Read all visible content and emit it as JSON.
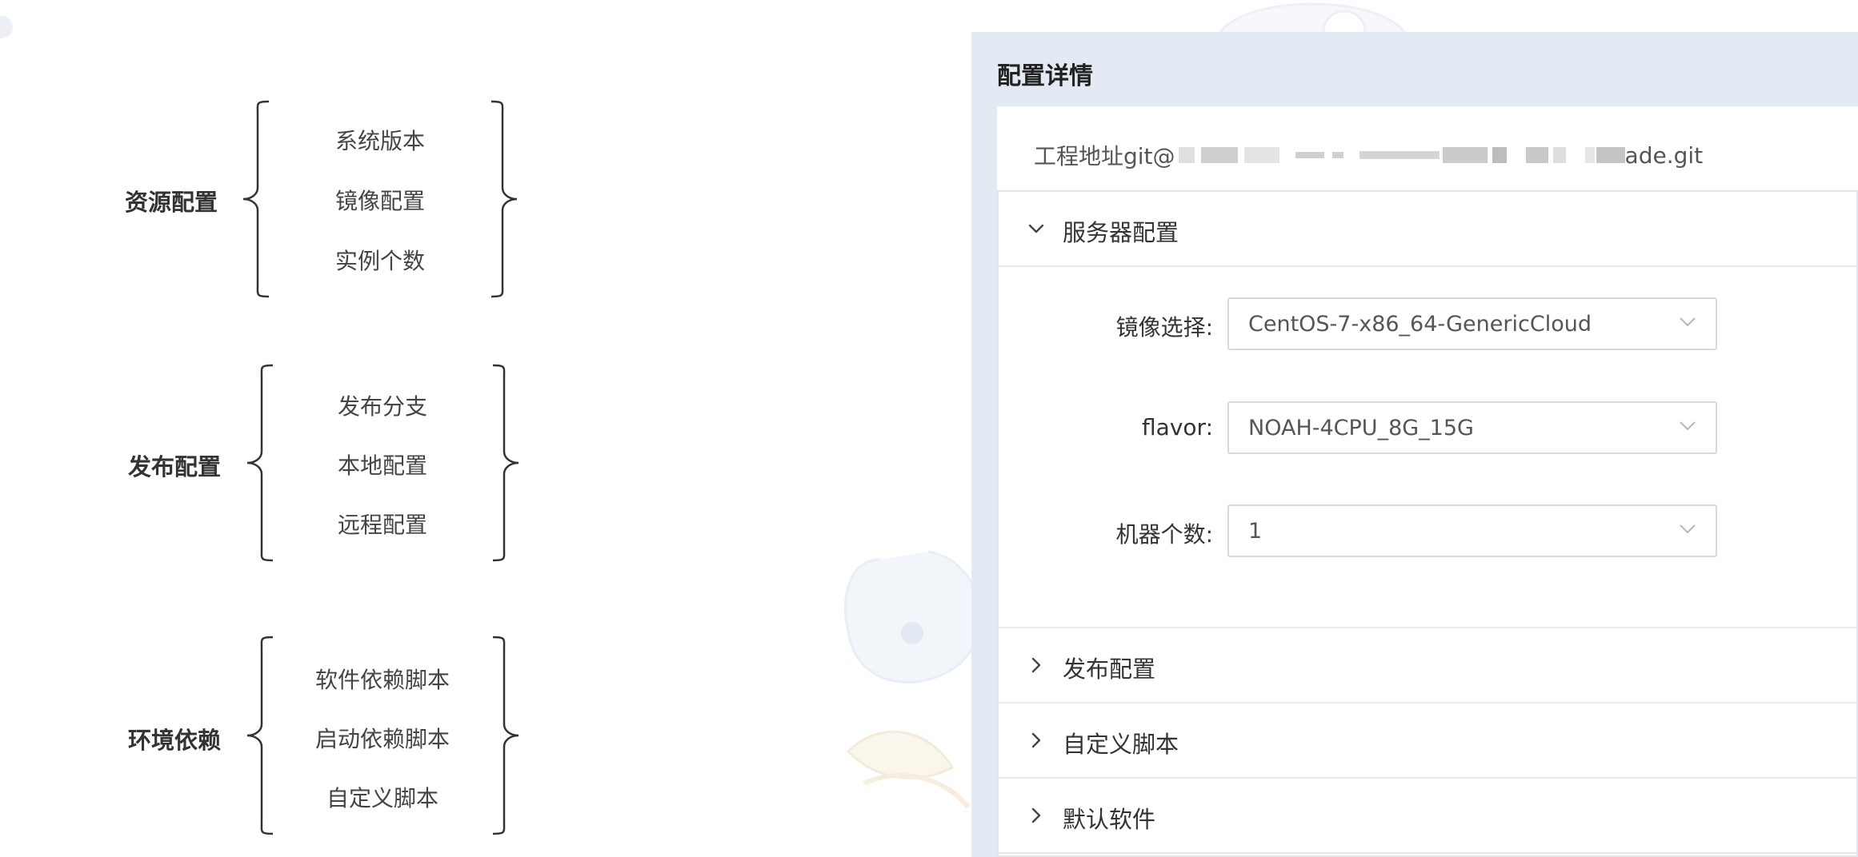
{
  "diagram": {
    "groups": [
      {
        "title": "资源配置",
        "items": [
          "系统版本",
          "镜像配置",
          "实例个数"
        ]
      },
      {
        "title": "发布配置",
        "items": [
          "发布分支",
          "本地配置",
          "远程配置"
        ]
      },
      {
        "title": "环境依赖",
        "items": [
          "软件依赖脚本",
          "启动依赖脚本",
          "自定义脚本"
        ]
      }
    ]
  },
  "panel": {
    "title": "配置详情",
    "repo": {
      "prefix": "工程地址git@",
      "suffix": "ade.git"
    },
    "sections": {
      "server": {
        "label": "服务器配置",
        "expanded": true,
        "fields": {
          "image": {
            "label": "镜像选择:",
            "value": "CentOS-7-x86_64-GenericCloud"
          },
          "flavor": {
            "label": "flavor:",
            "value": "NOAH-4CPU_8G_15G"
          },
          "count": {
            "label": "机器个数:",
            "value": "1"
          }
        }
      },
      "publish": {
        "label": "发布配置",
        "expanded": false
      },
      "custom_script": {
        "label": "自定义脚本",
        "expanded": false
      },
      "default_software": {
        "label": "默认软件",
        "expanded": false
      }
    }
  },
  "icons": {
    "expanded_arrow": "chevron-down-icon",
    "collapsed_arrow": "chevron-right-icon",
    "select_arrow": "select-chevron-down-icon"
  },
  "colors": {
    "panel_background": "#e3eaf3",
    "text": "#333333",
    "border": "#d9d9d9"
  }
}
